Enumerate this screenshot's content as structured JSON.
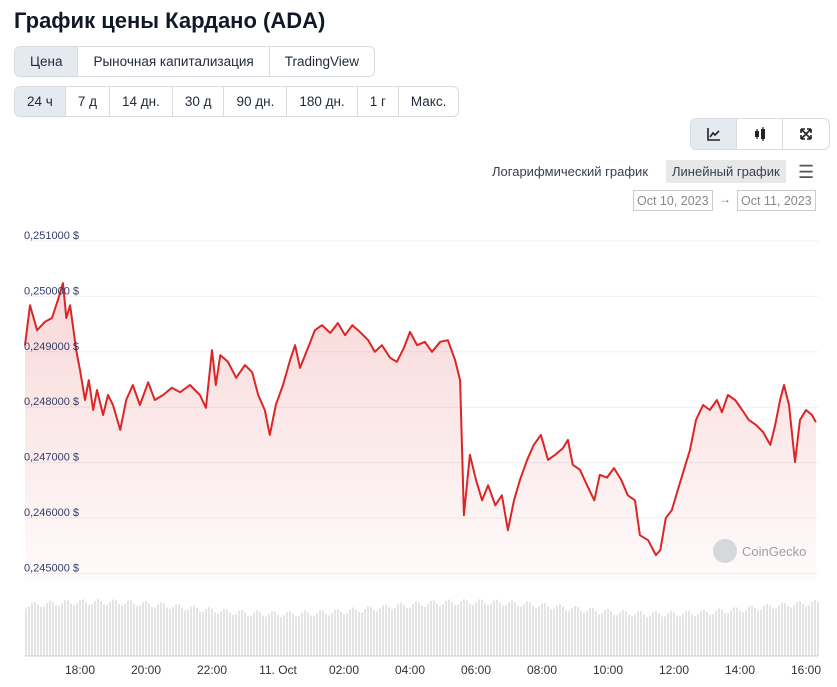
{
  "title": "График цены Кардано (ADA)",
  "tabs": [
    {
      "label": "Цена",
      "active": true
    },
    {
      "label": "Рыночная капитализация"
    },
    {
      "label": "TradingView"
    }
  ],
  "ranges": [
    {
      "label": "24 ч",
      "active": true
    },
    {
      "label": "7 д"
    },
    {
      "label": "14 дн."
    },
    {
      "label": "30 д"
    },
    {
      "label": "90 дн."
    },
    {
      "label": "180 дн."
    },
    {
      "label": "1 г"
    },
    {
      "label": "Макс."
    }
  ],
  "chart_types": [
    {
      "icon": "line-chart-icon",
      "active": true
    },
    {
      "icon": "candlestick-icon"
    },
    {
      "icon": "fullscreen-icon"
    }
  ],
  "scale": {
    "log_label": "Логарифмический график",
    "linear_label": "Линейный график",
    "selected": "linear"
  },
  "date_range": {
    "from": "Oct 10, 2023",
    "to": "Oct 11, 2023",
    "arrow": "→"
  },
  "watermark": "CoinGecko",
  "chart_data": {
    "type": "area",
    "line_color": "#dc2626",
    "yticks": [
      "0,251000 $",
      "0,250000 $",
      "0,249000 $",
      "0,248000 $",
      "0,247000 $",
      "0,246000 $",
      "0,245000 $"
    ],
    "ytick_values": [
      0.251,
      0.25,
      0.249,
      0.248,
      0.247,
      0.246,
      0.245
    ],
    "xticks": [
      "18:00",
      "20:00",
      "22:00",
      "11. Oct",
      "02:00",
      "04:00",
      "06:00",
      "08:00",
      "10:00",
      "12:00",
      "14:00",
      "16:00"
    ],
    "xtick_values": [
      "2023-10-10T18:00",
      "2023-10-10T20:00",
      "2023-10-10T22:00",
      "2023-10-11T00:00",
      "2023-10-11T02:00",
      "2023-10-11T04:00",
      "2023-10-11T06:00",
      "2023-10-11T08:00",
      "2023-10-11T10:00",
      "2023-10-11T12:00",
      "2023-10-11T14:00",
      "2023-10-11T16:00"
    ],
    "grid": true,
    "series": [
      {
        "points": [
          [
            "2023-10-10T16:20",
            0.24912
          ],
          [
            "2023-10-10T16:29",
            0.24984
          ],
          [
            "2023-10-10T16:42",
            0.24939
          ],
          [
            "2023-10-10T16:56",
            0.24954
          ],
          [
            "2023-10-10T17:09",
            0.24961
          ],
          [
            "2023-10-10T17:20",
            0.24994
          ],
          [
            "2023-10-10T17:29",
            0.25024
          ],
          [
            "2023-10-10T17:35",
            0.24961
          ],
          [
            "2023-10-10T17:42",
            0.24984
          ],
          [
            "2023-10-10T17:53",
            0.24903
          ],
          [
            "2023-10-10T18:00",
            0.24867
          ],
          [
            "2023-10-10T18:09",
            0.24813
          ],
          [
            "2023-10-10T18:16",
            0.24849
          ],
          [
            "2023-10-10T18:24",
            0.24795
          ],
          [
            "2023-10-10T18:31",
            0.24831
          ],
          [
            "2023-10-10T18:42",
            0.24786
          ],
          [
            "2023-10-10T18:51",
            0.24822
          ],
          [
            "2023-10-10T19:00",
            0.24804
          ],
          [
            "2023-10-10T19:13",
            0.24759
          ],
          [
            "2023-10-10T19:24",
            0.24813
          ],
          [
            "2023-10-10T19:36",
            0.2484
          ],
          [
            "2023-10-10T19:49",
            0.24804
          ],
          [
            "2023-10-10T20:04",
            0.24845
          ],
          [
            "2023-10-10T20:16",
            0.24813
          ],
          [
            "2023-10-10T20:31",
            0.24822
          ],
          [
            "2023-10-10T20:47",
            0.24835
          ],
          [
            "2023-10-10T21:02",
            0.24827
          ],
          [
            "2023-10-10T21:20",
            0.2484
          ],
          [
            "2023-10-10T21:38",
            0.24822
          ],
          [
            "2023-10-10T21:49",
            0.24799
          ],
          [
            "2023-10-10T22:00",
            0.24903
          ],
          [
            "2023-10-10T22:07",
            0.2484
          ],
          [
            "2023-10-10T22:15",
            0.24894
          ],
          [
            "2023-10-10T22:29",
            0.24882
          ],
          [
            "2023-10-10T22:44",
            0.24853
          ],
          [
            "2023-10-10T23:00",
            0.24876
          ],
          [
            "2023-10-10T23:13",
            0.24863
          ],
          [
            "2023-10-10T23:24",
            0.24822
          ],
          [
            "2023-10-10T23:36",
            0.24795
          ],
          [
            "2023-10-10T23:45",
            0.2475
          ],
          [
            "2023-10-10T23:56",
            0.24804
          ],
          [
            "2023-10-11T00:09",
            0.2484
          ],
          [
            "2023-10-11T00:22",
            0.24885
          ],
          [
            "2023-10-11T00:31",
            0.24912
          ],
          [
            "2023-10-11T00:40",
            0.24871
          ],
          [
            "2023-10-11T00:53",
            0.24903
          ],
          [
            "2023-10-11T01:07",
            0.24939
          ],
          [
            "2023-10-11T01:20",
            0.24948
          ],
          [
            "2023-10-11T01:35",
            0.24934
          ],
          [
            "2023-10-11T01:49",
            0.24952
          ],
          [
            "2023-10-11T02:02",
            0.2493
          ],
          [
            "2023-10-11T02:15",
            0.24948
          ],
          [
            "2023-10-11T02:29",
            0.24936
          ],
          [
            "2023-10-11T02:44",
            0.24921
          ],
          [
            "2023-10-11T02:56",
            0.249
          ],
          [
            "2023-10-11T03:09",
            0.24912
          ],
          [
            "2023-10-11T03:24",
            0.24889
          ],
          [
            "2023-10-11T03:36",
            0.24882
          ],
          [
            "2023-10-11T03:49",
            0.24907
          ],
          [
            "2023-10-11T04:00",
            0.24936
          ],
          [
            "2023-10-11T04:13",
            0.24912
          ],
          [
            "2023-10-11T04:27",
            0.24918
          ],
          [
            "2023-10-11T04:40",
            0.249
          ],
          [
            "2023-10-11T04:55",
            0.24918
          ],
          [
            "2023-10-11T05:09",
            0.24921
          ],
          [
            "2023-10-11T05:22",
            0.24885
          ],
          [
            "2023-10-11T05:31",
            0.24849
          ],
          [
            "2023-10-11T05:38",
            0.24605
          ],
          [
            "2023-10-11T05:49",
            0.24714
          ],
          [
            "2023-10-11T06:00",
            0.24669
          ],
          [
            "2023-10-11T06:11",
            0.24632
          ],
          [
            "2023-10-11T06:22",
            0.24659
          ],
          [
            "2023-10-11T06:35",
            0.24623
          ],
          [
            "2023-10-11T06:47",
            0.24641
          ],
          [
            "2023-10-11T06:58",
            0.24578
          ],
          [
            "2023-10-11T07:09",
            0.24632
          ],
          [
            "2023-10-11T07:20",
            0.24669
          ],
          [
            "2023-10-11T07:33",
            0.24705
          ],
          [
            "2023-10-11T07:45",
            0.24732
          ],
          [
            "2023-10-11T07:58",
            0.2475
          ],
          [
            "2023-10-11T08:11",
            0.24705
          ],
          [
            "2023-10-11T08:24",
            0.24714
          ],
          [
            "2023-10-11T08:38",
            0.24726
          ],
          [
            "2023-10-11T08:47",
            0.24741
          ],
          [
            "2023-10-11T08:56",
            0.24696
          ],
          [
            "2023-10-11T09:09",
            0.24687
          ],
          [
            "2023-10-11T09:22",
            0.24659
          ],
          [
            "2023-10-11T09:35",
            0.24632
          ],
          [
            "2023-10-11T09:45",
            0.24678
          ],
          [
            "2023-10-11T09:58",
            0.24673
          ],
          [
            "2023-10-11T10:11",
            0.2469
          ],
          [
            "2023-10-11T10:24",
            0.24669
          ],
          [
            "2023-10-11T10:36",
            0.24641
          ],
          [
            "2023-10-11T10:49",
            0.24632
          ],
          [
            "2023-10-11T10:58",
            0.24569
          ],
          [
            "2023-10-11T11:13",
            0.2456
          ],
          [
            "2023-10-11T11:27",
            0.24533
          ],
          [
            "2023-10-11T11:35",
            0.24542
          ],
          [
            "2023-10-11T11:45",
            0.246
          ],
          [
            "2023-10-11T11:56",
            0.24614
          ],
          [
            "2023-10-11T12:07",
            0.24651
          ],
          [
            "2023-10-11T12:18",
            0.24687
          ],
          [
            "2023-10-11T12:29",
            0.24723
          ],
          [
            "2023-10-11T12:40",
            0.24777
          ],
          [
            "2023-10-11T12:53",
            0.24804
          ],
          [
            "2023-10-11T13:05",
            0.24795
          ],
          [
            "2023-10-11T13:18",
            0.24813
          ],
          [
            "2023-10-11T13:27",
            0.24791
          ],
          [
            "2023-10-11T13:38",
            0.24822
          ],
          [
            "2023-10-11T13:51",
            0.24813
          ],
          [
            "2023-10-11T14:04",
            0.24795
          ],
          [
            "2023-10-11T14:16",
            0.24777
          ],
          [
            "2023-10-11T14:29",
            0.24768
          ],
          [
            "2023-10-11T14:42",
            0.24755
          ],
          [
            "2023-10-11T14:55",
            0.24732
          ],
          [
            "2023-10-11T15:04",
            0.24768
          ],
          [
            "2023-10-11T15:13",
            0.24813
          ],
          [
            "2023-10-11T15:20",
            0.2484
          ],
          [
            "2023-10-11T15:29",
            0.24804
          ],
          [
            "2023-10-11T15:40",
            0.24701
          ],
          [
            "2023-10-11T15:49",
            0.24777
          ],
          [
            "2023-10-11T16:00",
            0.24795
          ],
          [
            "2023-10-11T16:11",
            0.24786
          ],
          [
            "2023-10-11T16:18",
            0.24773
          ]
        ]
      }
    ]
  }
}
